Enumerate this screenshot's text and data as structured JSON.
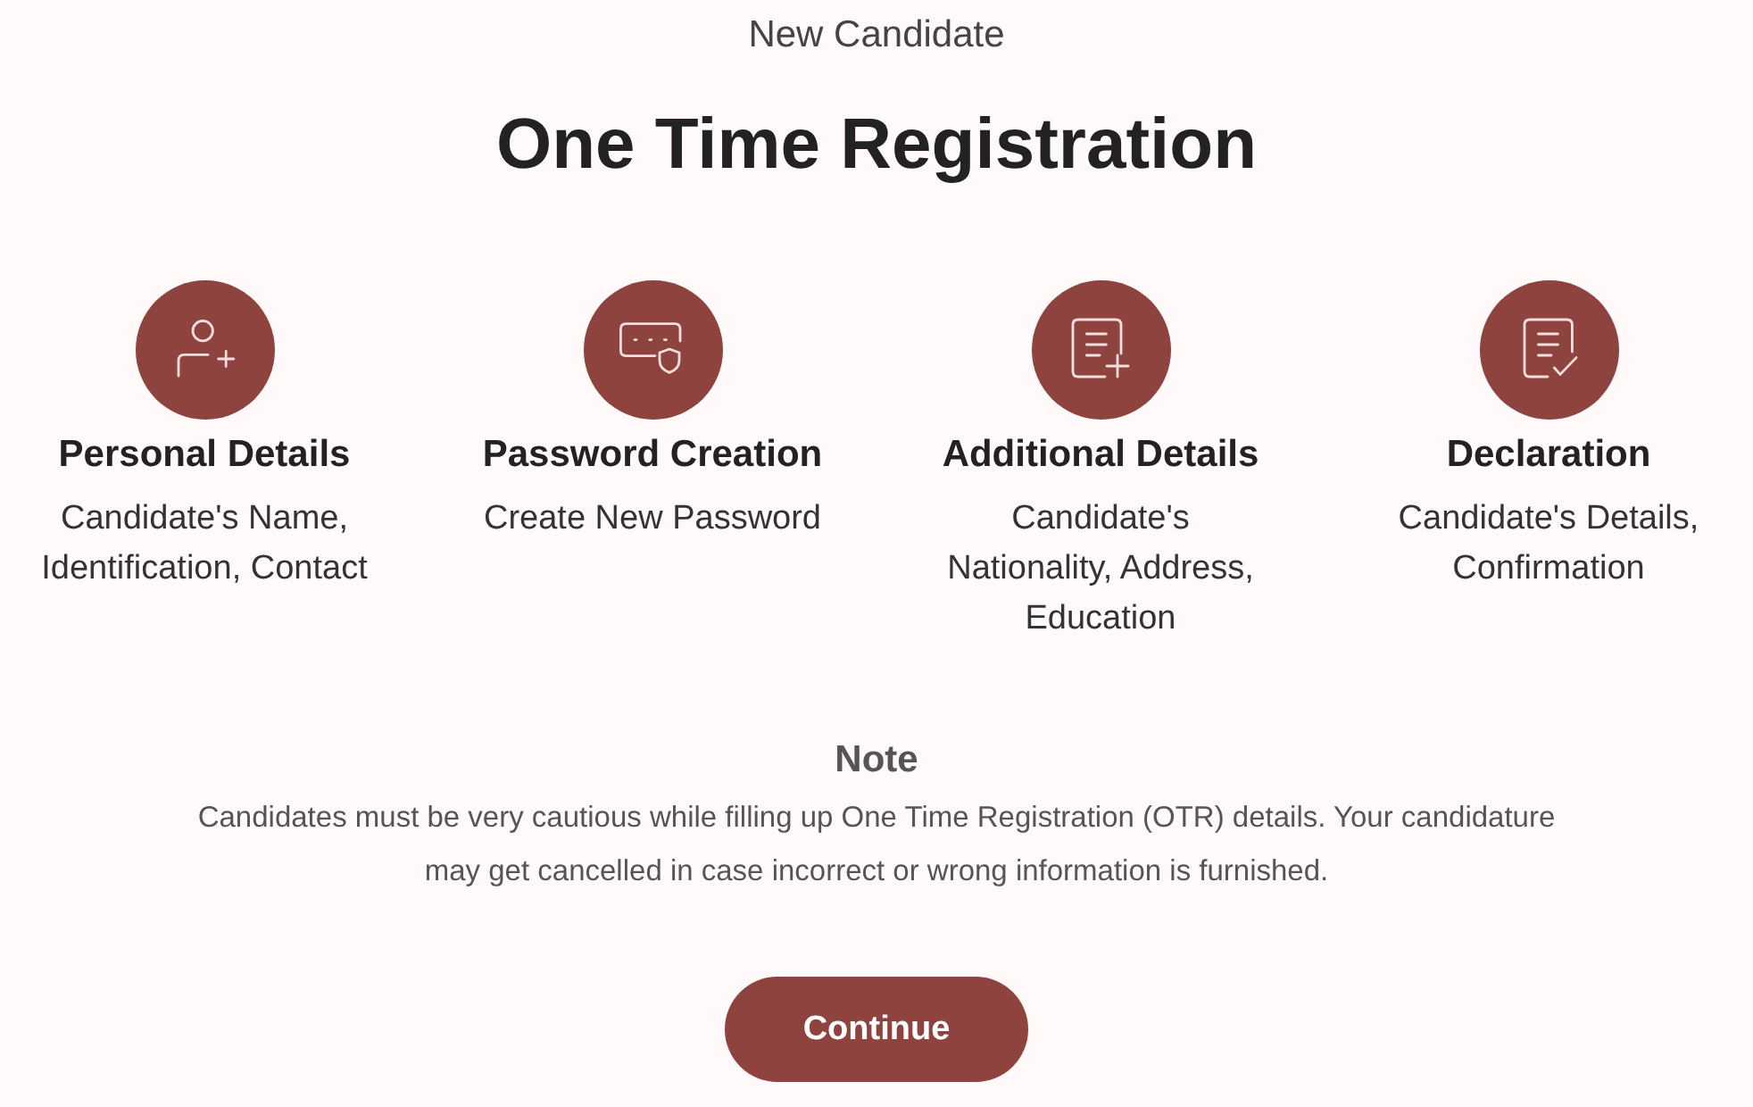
{
  "header": {
    "subtitle": "New Candidate",
    "title": "One Time Registration"
  },
  "steps": [
    {
      "kind": "person-plus",
      "title": "Personal Details",
      "description": "Candidate's Name,\nIdentification, Contact"
    },
    {
      "kind": "form-shield",
      "title": "Password Creation",
      "description": "Create New Password"
    },
    {
      "kind": "document-plus",
      "title": "Additional Details",
      "description": "Candidate's\nNationality, Address,\nEducation"
    },
    {
      "kind": "document-check",
      "title": "Declaration",
      "description": "Candidate's Details,\nConfirmation"
    }
  ],
  "note": {
    "title": "Note",
    "text": "Candidates must be very cautious while filling up One Time Registration (OTR) details. Your candidature\nmay get cancelled in case incorrect or wrong information is furnished."
  },
  "continue_button": {
    "label": "Continue"
  }
}
